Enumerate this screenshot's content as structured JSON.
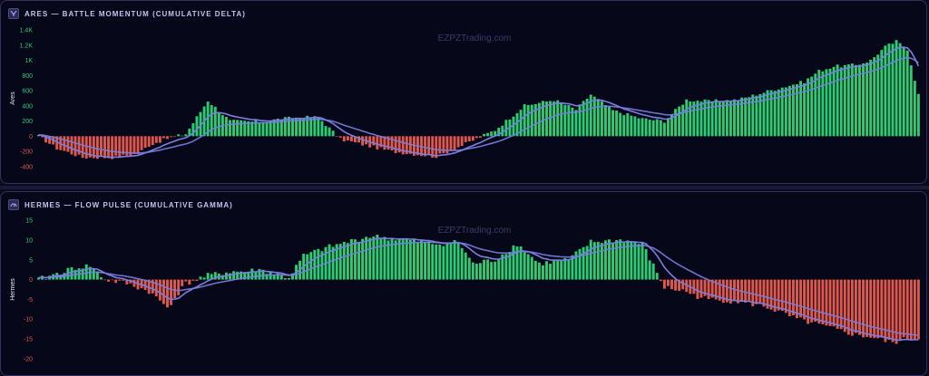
{
  "watermark": "EZPZTrading.com",
  "colors": {
    "positive_bar": "#2ecc71",
    "negative_bar": "#e0584c",
    "line": "#7b7ee0",
    "axis_text_pos": "#2ecc71",
    "axis_text_neg": "#e0584c",
    "axis_text_zero": "#e0584c",
    "panel_bg": "#07071a",
    "panel_border": "#34305e"
  },
  "panels": [
    {
      "title": "ARES — BATTLE MOMENTUM (CUMULATIVE DELTA)",
      "icon": "chart-icon",
      "ylabel": "Ares",
      "ticks": [
        "1.4K",
        "1.2K",
        "1K",
        "800",
        "600",
        "400",
        "200",
        "0",
        "-200",
        "-400"
      ]
    },
    {
      "title": "HERMES — FLOW PULSE (CUMULATIVE GAMMA)",
      "icon": "gauge-icon",
      "ylabel": "Hermes",
      "ticks": [
        "15",
        "10",
        "5",
        "0",
        "-5",
        "-10",
        "-15",
        "-20"
      ]
    }
  ],
  "chart_data": [
    {
      "type": "bar",
      "title": "ARES — BATTLE MOMENTUM (CUMULATIVE DELTA)",
      "ylabel": "Ares",
      "ylim": [
        -450,
        1450
      ],
      "grid": false,
      "n_bars": 240,
      "overlay_lines": 2,
      "profile_index": [
        0,
        5,
        12,
        20,
        27,
        30,
        35,
        40,
        46,
        52,
        60,
        66,
        72,
        76,
        82,
        96,
        108,
        116,
        124,
        132,
        140,
        146,
        150,
        156,
        164,
        170,
        176,
        182,
        190,
        200,
        208,
        212,
        216,
        222,
        226,
        230,
        233,
        236,
        239
      ],
      "profile_value": [
        0,
        -160,
        -280,
        -280,
        -230,
        -120,
        -30,
        30,
        470,
        200,
        190,
        230,
        250,
        250,
        -40,
        -200,
        -270,
        -100,
        80,
        400,
        480,
        350,
        550,
        340,
        230,
        200,
        480,
        460,
        480,
        620,
        720,
        860,
        920,
        940,
        1000,
        1180,
        1250,
        1150,
        550
      ]
    },
    {
      "type": "bar",
      "title": "HERMES — FLOW PULSE (CUMULATIVE GAMMA)",
      "ylabel": "Hermes",
      "ylim": [
        -20.5,
        15.5
      ],
      "grid": false,
      "n_bars": 240,
      "overlay_lines": 2,
      "profile_index": [
        0,
        5,
        10,
        14,
        18,
        24,
        30,
        35,
        40,
        46,
        52,
        56,
        60,
        68,
        72,
        78,
        84,
        90,
        100,
        108,
        114,
        118,
        124,
        130,
        136,
        144,
        150,
        158,
        164,
        170,
        176,
        178,
        182,
        190,
        198,
        206,
        214,
        222,
        226,
        232,
        236,
        239
      ],
      "profile_value": [
        0,
        1.5,
        3,
        3.5,
        0,
        -1,
        -3,
        -7,
        -1,
        1,
        2,
        2,
        2.5,
        0.5,
        6,
        8,
        9.5,
        11,
        10,
        9,
        9.5,
        4,
        5,
        9,
        4,
        5,
        9.5,
        10,
        9,
        -2,
        -3,
        -4,
        -5,
        -5.5,
        -7,
        -10,
        -12,
        -14,
        -14.5,
        -16,
        -15,
        -15
      ]
    }
  ]
}
